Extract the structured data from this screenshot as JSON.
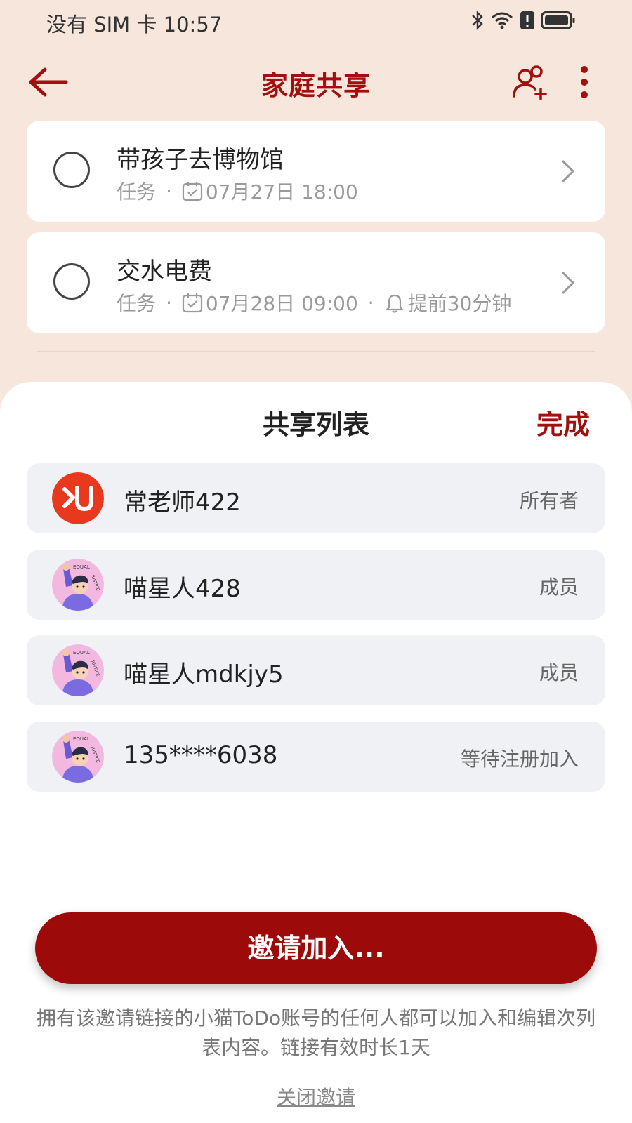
{
  "status_bar": {
    "carrier": "没有 SIM 卡",
    "time": "10:57",
    "icons": [
      "bluetooth-icon",
      "wifi-icon",
      "alert-icon",
      "battery-icon"
    ]
  },
  "header": {
    "title": "家庭共享",
    "icons": [
      "back-arrow-icon",
      "add-user-icon",
      "more-icon"
    ],
    "accent_color": "#a10f0f"
  },
  "tasks": [
    {
      "title": "带孩子去博物馆",
      "type": "任务",
      "date": "07月27日 18:00"
    },
    {
      "title": "交水电费",
      "type": "任务",
      "date": "07月28日 09:00",
      "reminder": "提前30分钟"
    }
  ],
  "sheet": {
    "title": "共享列表",
    "done_label": "完成",
    "members": [
      {
        "name": "常老师422",
        "role": "所有者",
        "avatar": "orange-logo-avatar"
      },
      {
        "name": "喵星人428",
        "role": "成员",
        "avatar": "equal-justice-avatar"
      },
      {
        "name": "喵星人mdkjy5",
        "role": "成员",
        "avatar": "equal-justice-avatar"
      },
      {
        "name": "135****6038",
        "role": "等待注册加入",
        "avatar": "equal-justice-avatar"
      }
    ],
    "avatar_text": "EQUAL JUSTICE",
    "invite_button": "邀请加入...",
    "note": "拥有该邀请链接的小猫ToDo账号的任何人都可以加入和编辑次列表内容。链接有效时长1天",
    "close_invite": "关闭邀请"
  }
}
